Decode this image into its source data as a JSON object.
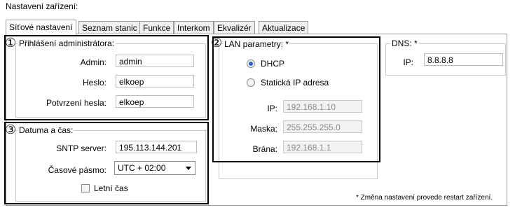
{
  "page": {
    "title": "Nastavení zařízení:"
  },
  "tabs": [
    {
      "label": "Síťové nastavení",
      "active": true
    },
    {
      "label": "Seznam stanic",
      "active": false
    },
    {
      "label": "Funkce",
      "active": false
    },
    {
      "label": "Interkom",
      "active": false
    },
    {
      "label": "Ekvalizér",
      "active": false
    },
    {
      "label": "Aktualizace",
      "active": false
    }
  ],
  "admin": {
    "marker": "①",
    "legend": "Přihlášení administrátora:",
    "admin_label": "Admin:",
    "admin_value": "admin",
    "password_label": "Heslo:",
    "password_value": "elkoep",
    "confirm_label": "Potvrzení hesla:",
    "confirm_value": "elkoep"
  },
  "lan": {
    "marker": "②",
    "legend": "LAN parametry: *",
    "dhcp_label": "DHCP",
    "dhcp_selected": true,
    "static_label": "Statická IP adresa",
    "static_selected": false,
    "ip_label": "IP:",
    "ip_value": "192.168.1.10",
    "mask_label": "Maska:",
    "mask_value": "255.255.255.0",
    "gateway_label": "Brána:",
    "gateway_value": "192.168.1.1"
  },
  "dns": {
    "legend": "DNS: *",
    "ip_label": "IP:",
    "ip_value": "8.8.8.8"
  },
  "datetime": {
    "marker": "③",
    "legend": "Datuma a čas:",
    "sntp_label": "SNTP server:",
    "sntp_value": "195.113.144.201",
    "tz_label": "Časové pásmo:",
    "tz_value": "UTC + 02:00",
    "dst_label": "Letní čas",
    "dst_checked": false
  },
  "footer": {
    "note": "* Změna nastavení provede restart zařízení."
  }
}
